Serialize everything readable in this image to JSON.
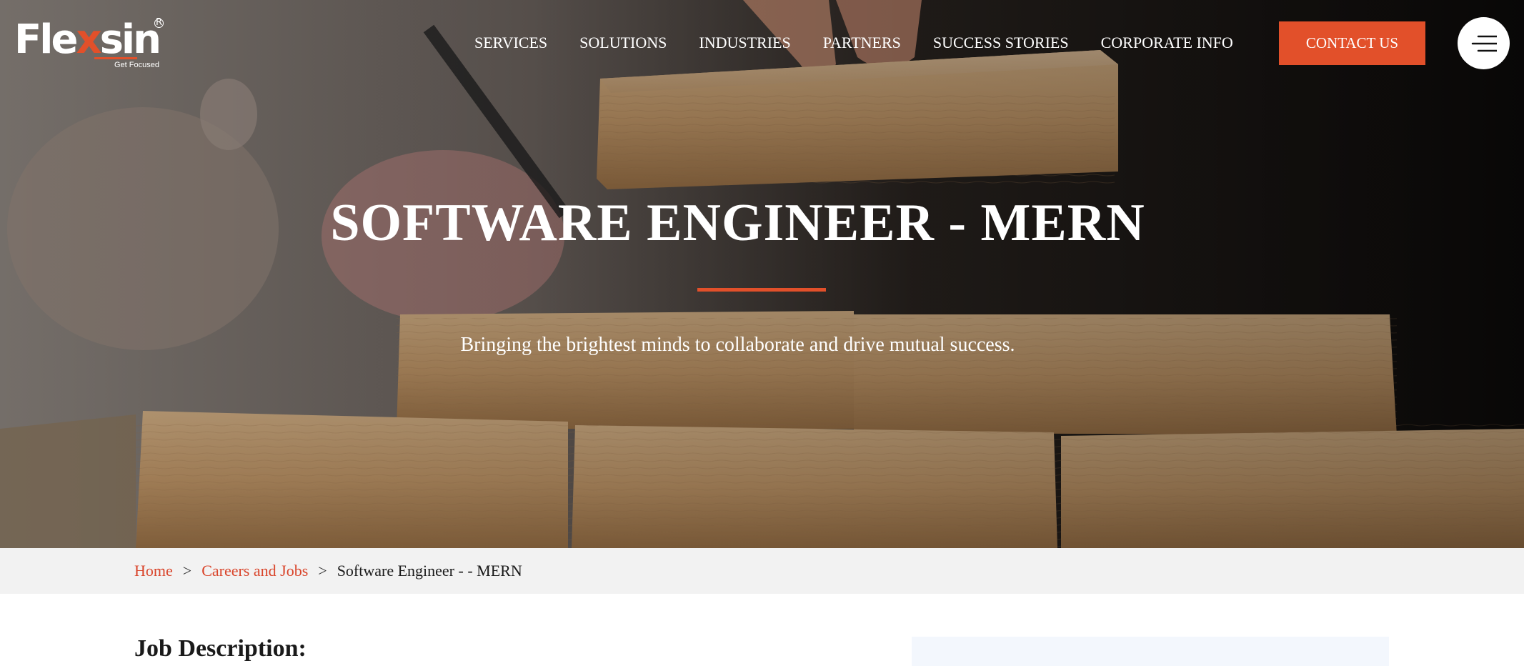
{
  "brand": {
    "logo_main": "Fle",
    "logo_x": "x",
    "logo_end": "sin",
    "logo_reg": "R",
    "tagline": "Get Focused"
  },
  "nav": {
    "items": [
      "SERVICES",
      "SOLUTIONS",
      "INDUSTRIES",
      "PARTNERS",
      "SUCCESS STORIES",
      "CORPORATE INFO"
    ],
    "contact_label": "CONTACT US",
    "menu_icon": "hamburger-icon"
  },
  "hero": {
    "title": "SOFTWARE ENGINEER - MERN",
    "subtitle": "Bringing the brightest minds to collaborate and drive mutual success."
  },
  "breadcrumb": {
    "home": "Home",
    "sep": ">",
    "careers": "Careers and Jobs",
    "current": "Software Engineer - - MERN"
  },
  "content": {
    "job_heading": "Job Description:"
  },
  "colors": {
    "accent": "#e2502a",
    "breadcrumb_bg": "#f2f2f2",
    "panel_bg": "#f3f7fd"
  }
}
